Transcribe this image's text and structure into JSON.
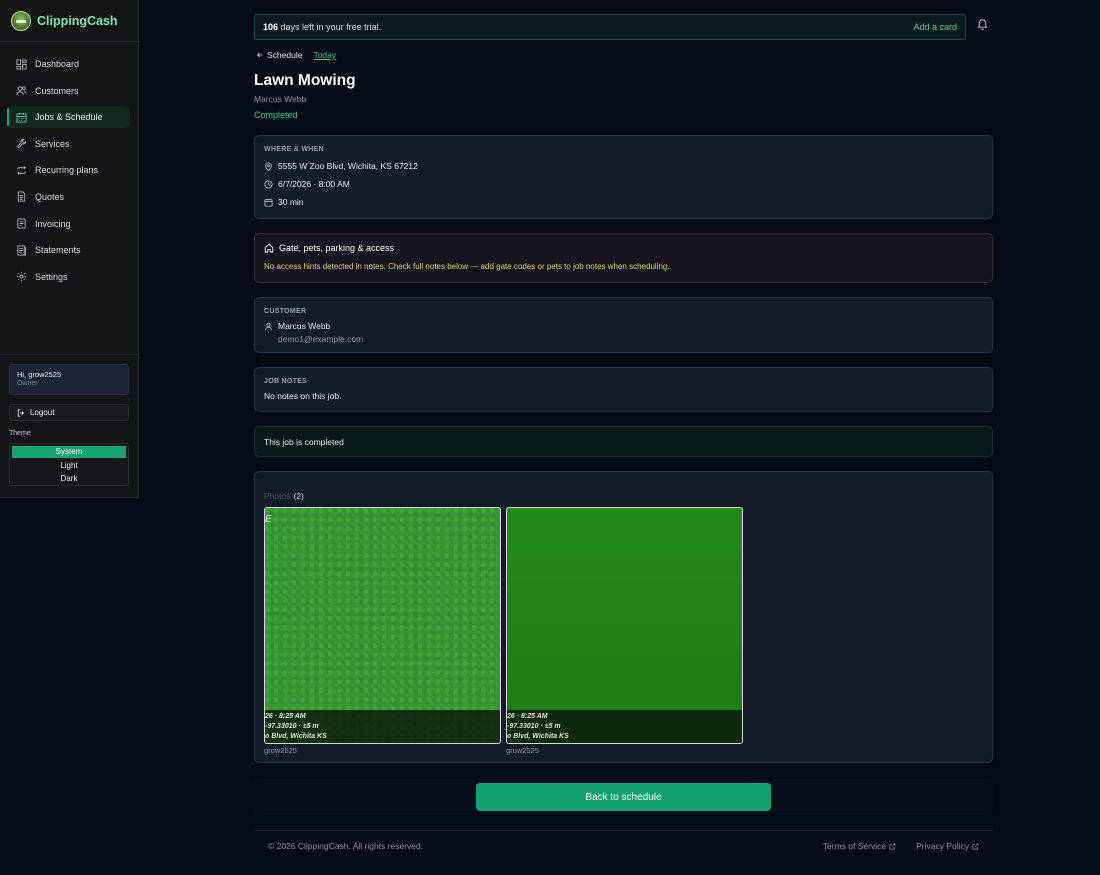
{
  "app": {
    "name": "ClippingCash"
  },
  "sidebar": {
    "items": [
      {
        "label": "Dashboard",
        "icon": "grid-icon"
      },
      {
        "label": "Customers",
        "icon": "users-icon"
      },
      {
        "label": "Jobs & Schedule",
        "icon": "calendar-icon",
        "active": true
      },
      {
        "label": "Services",
        "icon": "wrench-icon"
      },
      {
        "label": "Recurring plans",
        "icon": "repeat-icon"
      },
      {
        "label": "Quotes",
        "icon": "document-icon"
      },
      {
        "label": "Invoicing",
        "icon": "invoice-icon"
      },
      {
        "label": "Statements",
        "icon": "statement-icon"
      },
      {
        "label": "Settings",
        "icon": "gear-icon"
      }
    ],
    "user": {
      "greeting": "Hi, grow2525",
      "role": "Owner"
    },
    "logout_label": "Logout",
    "theme": {
      "label": "Theme",
      "options": [
        "System",
        "Light",
        "Dark"
      ],
      "selected": "System"
    }
  },
  "trial": {
    "days": "106",
    "text": "days left in your free trial.",
    "action": "Add a card"
  },
  "breadcrumb": {
    "back_label": "Schedule",
    "today_label": "Today"
  },
  "job": {
    "title": "Lawn Mowing",
    "customer": "Marcus Webb",
    "status": "Completed"
  },
  "where_when": {
    "label": "WHERE & WHEN",
    "address": "5555 W Zoo Blvd, Wichita, KS 67212",
    "datetime": "6/7/2026 · 8:00 AM",
    "duration": "30 min"
  },
  "access": {
    "title": "Gate, pets, parking & access",
    "message": "No access hints detected in notes. Check full notes below — add gate codes or pets to job notes when scheduling."
  },
  "customer": {
    "label": "CUSTOMER",
    "name": "Marcus Webb",
    "email": "demo1@example.com"
  },
  "notes": {
    "label": "JOB NOTES",
    "text": "No notes on this job."
  },
  "completed_banner": "This job is completed",
  "photos": {
    "label": "Photos",
    "count": "(2)",
    "items": [
      {
        "corner_mark": "E",
        "line1": "26 · 8:25 AM",
        "line2": "-97.33010 · ±5 m",
        "line3": "o Blvd, Wichita KS",
        "caption": "grow2525"
      },
      {
        "corner_mark": "",
        "line1": "26 · 8:25 AM",
        "line2": "-97.33010 · ±5 m",
        "line3": "o Blvd, Wichita KS",
        "caption": "grow2525"
      }
    ]
  },
  "back_button": "Back to schedule",
  "footer": {
    "copyright": "© 2026 ClippingCash. All rights reserved.",
    "terms": "Terms of Service",
    "privacy": "Privacy Policy"
  },
  "colors": {
    "accent": "#13a072",
    "link": "#3ec98d",
    "warning_text": "#e9cd73"
  }
}
